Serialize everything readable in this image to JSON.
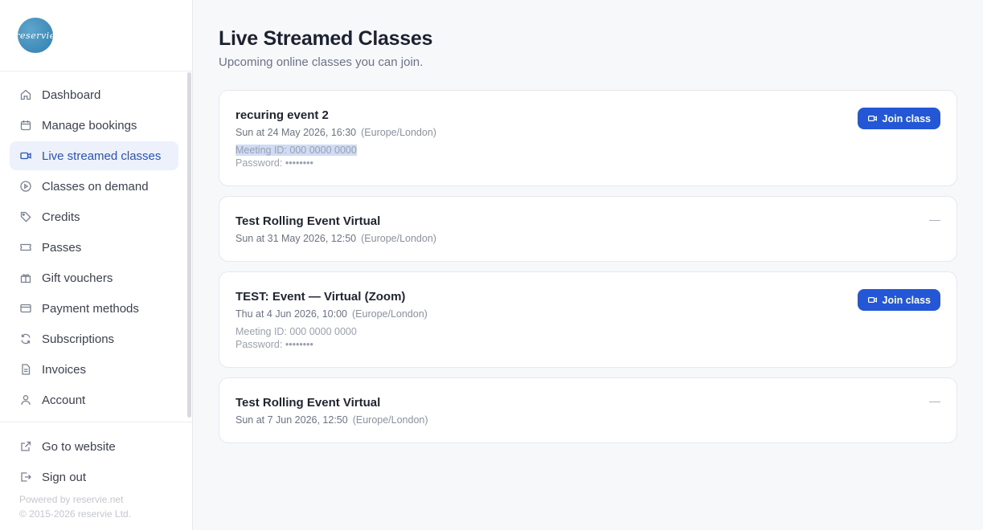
{
  "sidebar": {
    "logo_text": "reservie",
    "items": [
      {
        "label": "Dashboard",
        "icon": "home-icon"
      },
      {
        "label": "Manage bookings",
        "icon": "calendar-icon"
      },
      {
        "label": "Live streamed classes",
        "icon": "video-icon",
        "active": true
      },
      {
        "label": "Classes on demand",
        "icon": "play-circle-icon"
      },
      {
        "label": "Credits",
        "icon": "tag-icon"
      },
      {
        "label": "Passes",
        "icon": "ticket-icon"
      },
      {
        "label": "Gift vouchers",
        "icon": "gift-icon"
      },
      {
        "label": "Payment methods",
        "icon": "credit-card-icon"
      },
      {
        "label": "Subscriptions",
        "icon": "refresh-icon"
      },
      {
        "label": "Invoices",
        "icon": "document-icon"
      },
      {
        "label": "Account",
        "icon": "user-icon"
      }
    ],
    "bottom_items": [
      {
        "label": "Go to website",
        "icon": "external-link-icon"
      },
      {
        "label": "Sign out",
        "icon": "sign-out-icon"
      }
    ],
    "powered_by": "Powered by reservie.net",
    "copyright": "© 2015-2026 reservie Ltd."
  },
  "page": {
    "title": "Live Streamed Classes",
    "subtitle": "Upcoming online classes you can join."
  },
  "classes": [
    {
      "title": "recuring event 2",
      "date": "Sun at 24 May 2026, 16:30",
      "timezone": "(Europe/London)",
      "meeting_id": "Meeting ID: 000 0000 0000",
      "password": "Password: ••••••••",
      "action": "Join class"
    },
    {
      "title": "Test Rolling Event Virtual",
      "date": "Sun at 31 May 2026, 12:50",
      "timezone": "(Europe/London)",
      "status": "—"
    },
    {
      "title": "TEST: Event — Virtual (Zoom)",
      "date": "Thu at 4 Jun 2026, 10:00",
      "timezone": "(Europe/London)",
      "meeting_id": "Meeting ID: 000 0000 0000",
      "password": "Password: ••••••••",
      "action": "Join class"
    },
    {
      "title": "Test Rolling Event Virtual",
      "date": "Sun at 7 Jun 2026, 12:50",
      "timezone": "(Europe/London)",
      "status": "—"
    }
  ],
  "colors": {
    "accent": "#2357d6",
    "active_bg": "#edf1fb",
    "active_text": "#2b53b3",
    "selection_highlight": "#cfdcf6"
  }
}
